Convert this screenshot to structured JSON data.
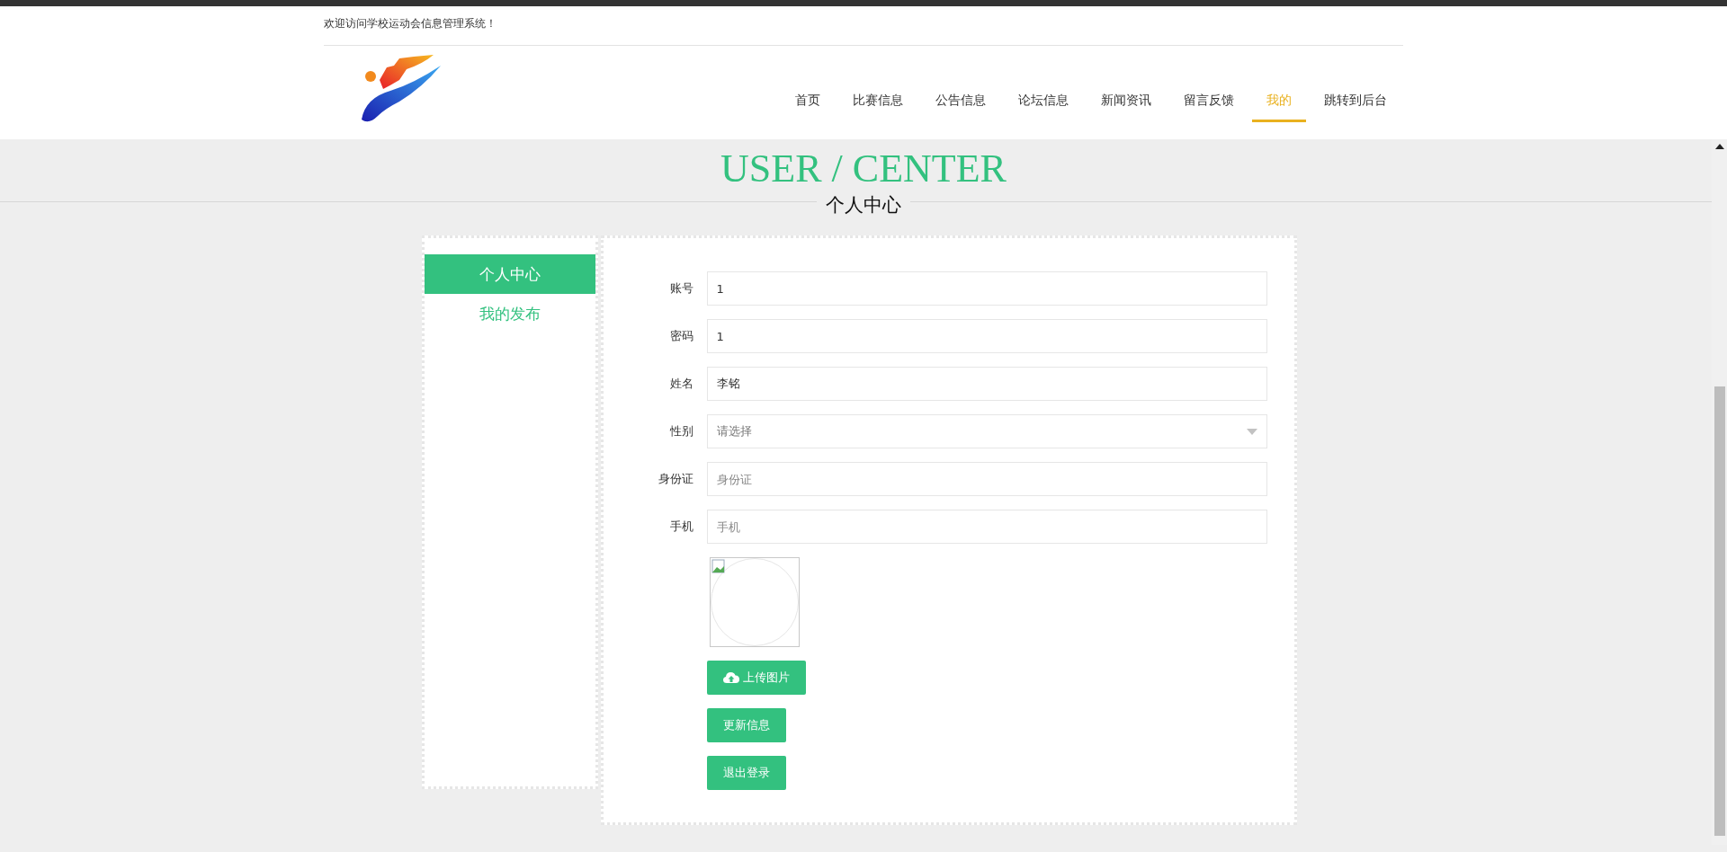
{
  "header": {
    "welcome": "欢迎访问学校运动会信息管理系统！"
  },
  "nav": [
    {
      "label": "首页",
      "selected": false
    },
    {
      "label": "比赛信息",
      "selected": false
    },
    {
      "label": "公告信息",
      "selected": false
    },
    {
      "label": "论坛信息",
      "selected": false
    },
    {
      "label": "新闻资讯",
      "selected": false
    },
    {
      "label": "留言反馈",
      "selected": false
    },
    {
      "label": "我的",
      "selected": true
    },
    {
      "label": "跳转到后台",
      "selected": false
    }
  ],
  "banner": {
    "title": "USER / CENTER",
    "subtitle": "个人中心"
  },
  "sidebar": [
    {
      "label": "个人中心",
      "selected": true
    },
    {
      "label": "我的发布",
      "selected": false
    }
  ],
  "form": {
    "fields": [
      {
        "kind": "input",
        "label": "账号",
        "value": "1"
      },
      {
        "kind": "input",
        "label": "密码",
        "value": "1"
      },
      {
        "kind": "input",
        "label": "姓名",
        "value": "李铭"
      },
      {
        "kind": "select",
        "label": "性别",
        "placeholder": "请选择"
      },
      {
        "kind": "input",
        "label": "身份证",
        "placeholder": "身份证"
      },
      {
        "kind": "input",
        "label": "手机",
        "placeholder": "手机"
      }
    ],
    "buttons": [
      {
        "kind": "upload",
        "label": "上传图片"
      },
      {
        "kind": "plain",
        "label": "更新信息"
      },
      {
        "kind": "plain",
        "label": "退出登录"
      }
    ]
  }
}
